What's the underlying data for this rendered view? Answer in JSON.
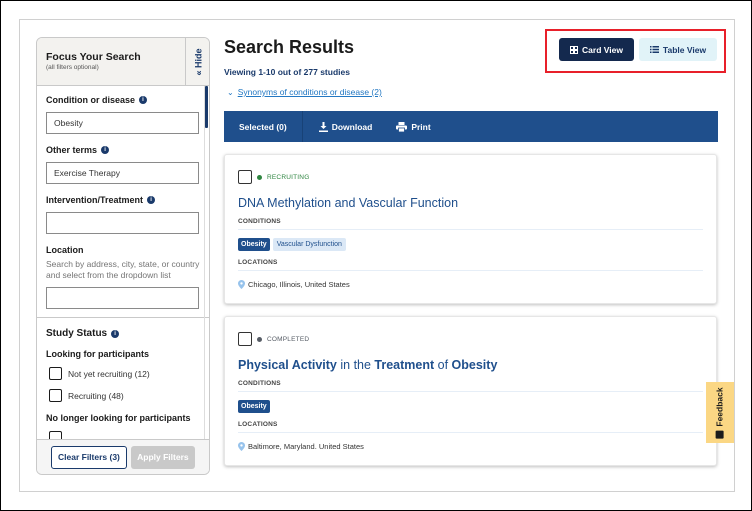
{
  "sidebar": {
    "title": "Focus Your Search",
    "subtitle": "(all filters optional)",
    "hide_label": "Hide",
    "hide_icon": "«",
    "fields": {
      "condition": {
        "label": "Condition or disease",
        "value": "Obesity"
      },
      "other_terms": {
        "label": "Other terms",
        "value": "Exercise Therapy"
      },
      "intervention": {
        "label": "Intervention/Treatment",
        "value": ""
      },
      "location": {
        "label": "Location",
        "help": "Search by address, city, state, or country and select from the dropdown list",
        "value": ""
      }
    },
    "study_status": {
      "title": "Study Status",
      "looking_label": "Looking for participants",
      "options": [
        {
          "label": "Not yet recruiting (12)",
          "checked": false
        },
        {
          "label": "Recruiting (48)",
          "checked": false
        }
      ],
      "no_longer_label": "No longer looking for participants"
    },
    "clear_label": "Clear Filters (3)",
    "apply_label": "Apply Filters"
  },
  "main": {
    "title": "Search Results",
    "viewing": "Viewing 1-10 out of 277 studies",
    "synonyms_link": "Synonyms of conditions or disease (2)",
    "view_toggle": {
      "card_label": "Card View",
      "table_label": "Table View",
      "active": "card"
    },
    "action_bar": {
      "selected": "Selected (0)",
      "download": "Download",
      "print": "Print"
    },
    "results": [
      {
        "status": "RECRUITING",
        "status_color": "#2e8540",
        "title": "DNA Methylation and Vascular Function",
        "conditions_label": "CONDITIONS",
        "conditions": [
          {
            "label": "Obesity",
            "primary": true
          },
          {
            "label": "Vascular Dysfunction",
            "primary": false
          }
        ],
        "locations_label": "LOCATIONS",
        "location": "Chicago, Illinois, United States"
      },
      {
        "status": "COMPLETED",
        "status_color": "#565c65",
        "title_parts": [
          {
            "text": "Physical Activity",
            "bold": true
          },
          {
            "text": " in the ",
            "bold": false
          },
          {
            "text": "Treatment",
            "bold": true
          },
          {
            "text": " of ",
            "bold": false
          },
          {
            "text": "Obesity",
            "bold": true
          }
        ],
        "conditions_label": "CONDITIONS",
        "conditions": [
          {
            "label": "Obesity",
            "primary": true
          }
        ],
        "locations_label": "LOCATIONS",
        "location": "Baltimore, Maryland. United States"
      }
    ]
  },
  "feedback": {
    "label": "Feedback"
  },
  "colors": {
    "primary_dark": "#14294e",
    "primary": "#1f4f8c",
    "link": "#2378c3",
    "highlight": "#e8202a",
    "feedback_bg": "#fbd784"
  }
}
